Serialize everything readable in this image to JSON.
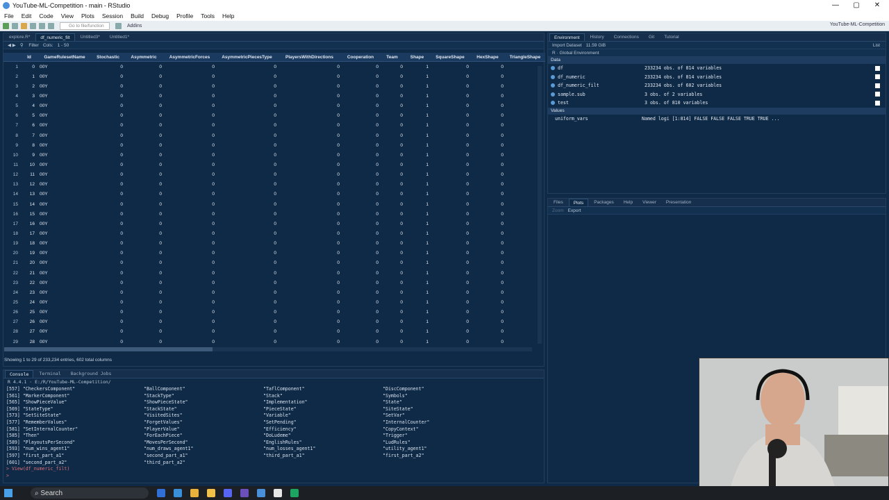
{
  "window": {
    "title": "YouTube-ML-Competition - main - RStudio",
    "min": "—",
    "max": "▢",
    "close": "✕"
  },
  "menu": [
    "File",
    "Edit",
    "Code",
    "View",
    "Plots",
    "Session",
    "Build",
    "Debug",
    "Profile",
    "Tools",
    "Help"
  ],
  "toolbar": {
    "goto_placeholder": "Go to file/function",
    "addins": "Addins",
    "project": "YouTube-ML-Competition"
  },
  "source": {
    "tabs": [
      "explore.R*",
      "df_numeric_filt",
      "Untitled3*",
      "Untitled1*"
    ],
    "active_tab": 1,
    "subbar": {
      "filter": "Filter",
      "cols": "Cols:",
      "range": "1 - 50"
    },
    "columns": [
      "Id",
      "GameRulesetName",
      "Stochastic",
      "Asymmetric",
      "AsymmetricForces",
      "AsymmetricPiecesType",
      "PlayersWithDirections",
      "Cooperation",
      "Team",
      "Shape",
      "SquareShape",
      "HexShape",
      "TriangleShape"
    ],
    "rows": [
      [
        "1",
        "0",
        "00Y",
        "0",
        "0",
        "0",
        "0",
        "0",
        "0",
        "0",
        "1",
        "0",
        "0"
      ],
      [
        "2",
        "1",
        "00Y",
        "0",
        "0",
        "0",
        "0",
        "0",
        "0",
        "0",
        "1",
        "0",
        "0"
      ],
      [
        "3",
        "2",
        "00Y",
        "0",
        "0",
        "0",
        "0",
        "0",
        "0",
        "0",
        "1",
        "0",
        "0"
      ],
      [
        "4",
        "3",
        "00Y",
        "0",
        "0",
        "0",
        "0",
        "0",
        "0",
        "0",
        "1",
        "0",
        "0"
      ],
      [
        "5",
        "4",
        "00Y",
        "0",
        "0",
        "0",
        "0",
        "0",
        "0",
        "0",
        "1",
        "0",
        "0"
      ],
      [
        "6",
        "5",
        "00Y",
        "0",
        "0",
        "0",
        "0",
        "0",
        "0",
        "0",
        "1",
        "0",
        "0"
      ],
      [
        "7",
        "6",
        "00Y",
        "0",
        "0",
        "0",
        "0",
        "0",
        "0",
        "0",
        "1",
        "0",
        "0"
      ],
      [
        "8",
        "7",
        "00Y",
        "0",
        "0",
        "0",
        "0",
        "0",
        "0",
        "0",
        "1",
        "0",
        "0"
      ],
      [
        "9",
        "8",
        "00Y",
        "0",
        "0",
        "0",
        "0",
        "0",
        "0",
        "0",
        "1",
        "0",
        "0"
      ],
      [
        "10",
        "9",
        "00Y",
        "0",
        "0",
        "0",
        "0",
        "0",
        "0",
        "0",
        "1",
        "0",
        "0"
      ],
      [
        "11",
        "10",
        "00Y",
        "0",
        "0",
        "0",
        "0",
        "0",
        "0",
        "0",
        "1",
        "0",
        "0"
      ],
      [
        "12",
        "11",
        "00Y",
        "0",
        "0",
        "0",
        "0",
        "0",
        "0",
        "0",
        "1",
        "0",
        "0"
      ],
      [
        "13",
        "12",
        "00Y",
        "0",
        "0",
        "0",
        "0",
        "0",
        "0",
        "0",
        "1",
        "0",
        "0"
      ],
      [
        "14",
        "13",
        "00Y",
        "0",
        "0",
        "0",
        "0",
        "0",
        "0",
        "0",
        "1",
        "0",
        "0"
      ],
      [
        "15",
        "14",
        "00Y",
        "0",
        "0",
        "0",
        "0",
        "0",
        "0",
        "0",
        "1",
        "0",
        "0"
      ],
      [
        "16",
        "15",
        "00Y",
        "0",
        "0",
        "0",
        "0",
        "0",
        "0",
        "0",
        "1",
        "0",
        "0"
      ],
      [
        "17",
        "16",
        "00Y",
        "0",
        "0",
        "0",
        "0",
        "0",
        "0",
        "0",
        "1",
        "0",
        "0"
      ],
      [
        "18",
        "17",
        "00Y",
        "0",
        "0",
        "0",
        "0",
        "0",
        "0",
        "0",
        "1",
        "0",
        "0"
      ],
      [
        "19",
        "18",
        "00Y",
        "0",
        "0",
        "0",
        "0",
        "0",
        "0",
        "0",
        "1",
        "0",
        "0"
      ],
      [
        "20",
        "19",
        "00Y",
        "0",
        "0",
        "0",
        "0",
        "0",
        "0",
        "0",
        "1",
        "0",
        "0"
      ],
      [
        "21",
        "20",
        "00Y",
        "0",
        "0",
        "0",
        "0",
        "0",
        "0",
        "0",
        "1",
        "0",
        "0"
      ],
      [
        "22",
        "21",
        "00Y",
        "0",
        "0",
        "0",
        "0",
        "0",
        "0",
        "0",
        "1",
        "0",
        "0"
      ],
      [
        "23",
        "22",
        "00Y",
        "0",
        "0",
        "0",
        "0",
        "0",
        "0",
        "0",
        "1",
        "0",
        "0"
      ],
      [
        "24",
        "23",
        "00Y",
        "0",
        "0",
        "0",
        "0",
        "0",
        "0",
        "0",
        "1",
        "0",
        "0"
      ],
      [
        "25",
        "24",
        "00Y",
        "0",
        "0",
        "0",
        "0",
        "0",
        "0",
        "0",
        "1",
        "0",
        "0"
      ],
      [
        "26",
        "25",
        "00Y",
        "0",
        "0",
        "0",
        "0",
        "0",
        "0",
        "0",
        "1",
        "0",
        "0"
      ],
      [
        "27",
        "26",
        "00Y",
        "0",
        "0",
        "0",
        "0",
        "0",
        "0",
        "0",
        "1",
        "0",
        "0"
      ],
      [
        "28",
        "27",
        "00Y",
        "0",
        "0",
        "0",
        "0",
        "0",
        "0",
        "0",
        "1",
        "0",
        "0"
      ],
      [
        "29",
        "28",
        "00Y",
        "0",
        "0",
        "0",
        "0",
        "0",
        "0",
        "0",
        "1",
        "0",
        "0"
      ]
    ],
    "status": "Showing 1 to 29 of 233,234 entries, 602 total columns"
  },
  "console": {
    "tabs": [
      "Console",
      "Terminal",
      "Background Jobs"
    ],
    "path": "R 4.4.1 · E:/R/YouTube-ML-Competition/",
    "lines": [
      [
        "[557] \"CheckersComponent\"",
        "\"BallComponent\"",
        "\"TaflComponent\"",
        "\"DiscComponent\""
      ],
      [
        "[561] \"MarkerComponent\"",
        "\"StackType\"",
        "\"Stack\"",
        "\"Symbols\""
      ],
      [
        "[565] \"ShowPieceValue\"",
        "\"ShowPieceState\"",
        "\"Implementation\"",
        "\"State\""
      ],
      [
        "[569] \"StateType\"",
        "\"StackState\"",
        "\"PieceState\"",
        "\"SiteState\""
      ],
      [
        "[573] \"SetSiteState\"",
        "\"VisitedSites\"",
        "\"Variable\"",
        "\"SetVar\""
      ],
      [
        "[577] \"RememberValues\"",
        "\"ForgetValues\"",
        "\"SetPending\"",
        "\"InternalCounter\""
      ],
      [
        "[581] \"SetInternalCounter\"",
        "\"PlayerValue\"",
        "\"Efficiency\"",
        "\"CopyContext\""
      ],
      [
        "[585] \"Then\"",
        "\"ForEachPiece\"",
        "\"DoLudeme\"",
        "\"Trigger\""
      ],
      [
        "[589] \"PlayoutsPerSecond\"",
        "\"MovesPerSecond\"",
        "\"EnglishRules\"",
        "\"LudRules\""
      ],
      [
        "[593] \"num_wins_agent1\"",
        "\"num_draws_agent1\"",
        "\"num_losses_agent1\"",
        "\"utility_agent1\""
      ],
      [
        "[597] \"first_part_a1\"",
        "\"second_part_a1\"",
        "\"third_part_a1\"",
        "\"first_part_a2\""
      ],
      [
        "[601] \"second_part_a2\"",
        "\"third_part_a2\"",
        "",
        ""
      ]
    ],
    "command": "> View(df_numeric_filt)",
    "prompt": ">"
  },
  "environment": {
    "tabs": [
      "Environment",
      "History",
      "Connections",
      "Git",
      "Tutorial"
    ],
    "import": "Import Dataset",
    "memory": "11.59 GiB",
    "scope": "R · Global Environment",
    "list": "List",
    "data_header": "Data",
    "data": [
      {
        "name": "df",
        "desc": "233234 obs. of 814 variables"
      },
      {
        "name": "df_numeric",
        "desc": "233234 obs. of 814 variables"
      },
      {
        "name": "df_numeric_filt",
        "desc": "233234 obs. of 602 variables"
      },
      {
        "name": "sample.sub",
        "desc": "3 obs. of 2 variables"
      },
      {
        "name": "test",
        "desc": "3 obs. of 810 variables"
      }
    ],
    "values_header": "Values",
    "values": [
      {
        "name": "uniform_vars",
        "desc": "Named logi [1:814] FALSE FALSE FALSE TRUE TRUE ..."
      }
    ]
  },
  "files": {
    "tabs": [
      "Files",
      "Plots",
      "Packages",
      "Help",
      "Viewer",
      "Presentation"
    ],
    "active_tab": 1,
    "zoom": "Zoom",
    "export": "Export"
  },
  "taskbar": {
    "search": "Search"
  }
}
